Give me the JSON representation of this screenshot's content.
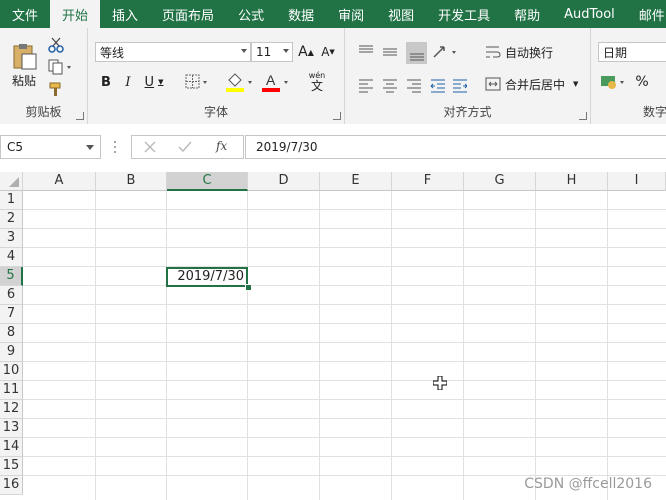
{
  "tabs": [
    "文件",
    "开始",
    "插入",
    "页面布局",
    "公式",
    "数据",
    "审阅",
    "视图",
    "开发工具",
    "帮助",
    "AudTool",
    "邮件"
  ],
  "active_tab_index": 1,
  "clipboard": {
    "paste": "粘贴",
    "label": "剪贴板"
  },
  "font": {
    "name": "等线",
    "size": "11",
    "bold": "B",
    "italic": "I",
    "underline": "U",
    "grow": "A",
    "shrink": "A",
    "font_color_letter": "A",
    "wen": "wén",
    "wen_char": "文",
    "label": "字体"
  },
  "alignment": {
    "wrap": "自动换行",
    "merge": "合并后居中",
    "label": "对齐方式"
  },
  "number": {
    "format": "日期",
    "percent": "%",
    "label": "数字"
  },
  "formula_bar": {
    "name_box": "C5",
    "fx": "fx",
    "formula": "2019/7/30"
  },
  "columns": [
    "A",
    "B",
    "C",
    "D",
    "E",
    "F",
    "G",
    "H",
    "I"
  ],
  "rows": [
    "1",
    "2",
    "3",
    "4",
    "5",
    "6",
    "7",
    "8",
    "9",
    "10",
    "11",
    "12",
    "13",
    "14",
    "15",
    "16"
  ],
  "selected_column": "C",
  "selected_row": "5",
  "cell_c5": "2019/7/30",
  "watermark": "CSDN @ffcell2016",
  "colors": {
    "accent": "#217346",
    "ribbon_bg": "#f3f3f3",
    "highlight_yellow": "#ffff00",
    "font_red": "#ff0000"
  }
}
